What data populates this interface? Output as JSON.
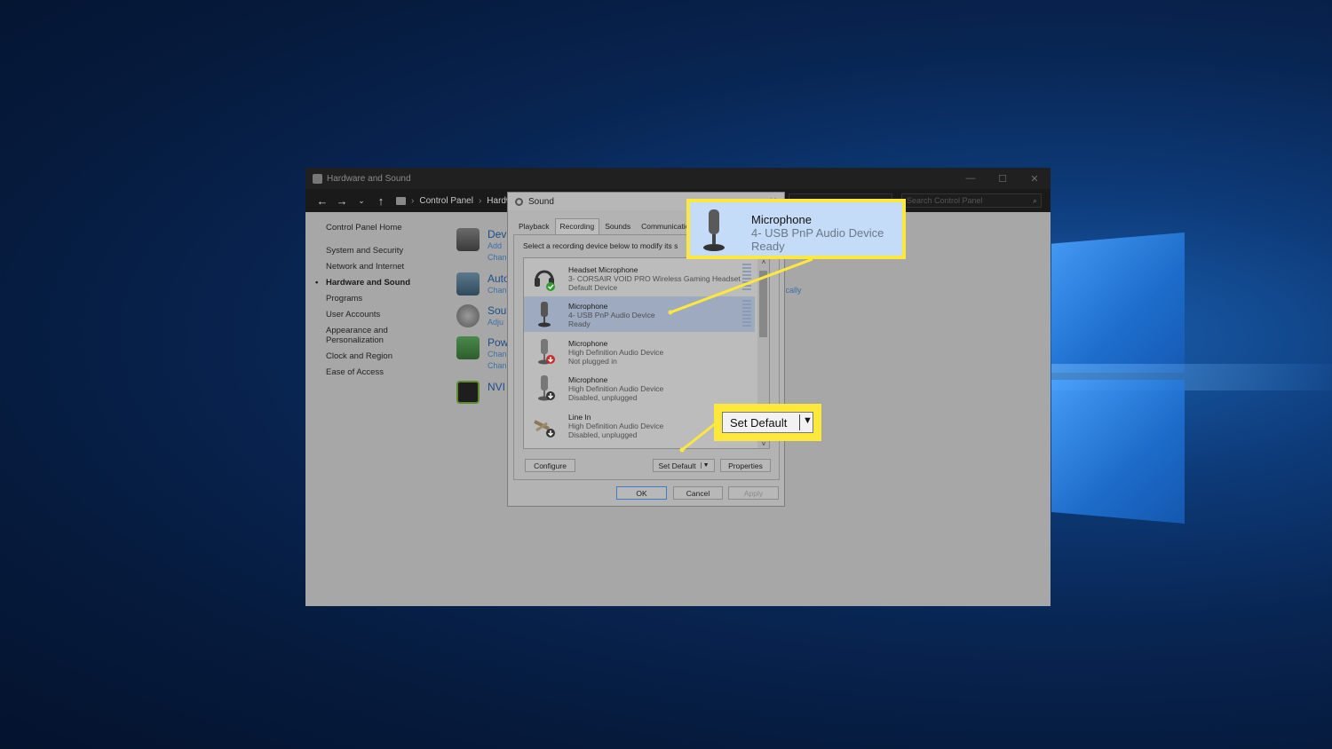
{
  "colors": {
    "callout_border": "#ffe83c",
    "selection": "#9daac0",
    "link": "#1b4d8c"
  },
  "cp_window": {
    "title": "Hardware and Sound",
    "breadcrumb": [
      "Control Panel",
      "Hardware"
    ],
    "search_placeholder": "Search Control Panel"
  },
  "sidebar": {
    "home": "Control Panel Home",
    "items": [
      "System and Security",
      "Network and Internet",
      "Hardware and Sound",
      "Programs",
      "User Accounts",
      "Appearance and Personalization",
      "Clock and Region",
      "Ease of Access"
    ]
  },
  "categories": [
    {
      "title": "Devi",
      "lines": [
        "Add",
        "Chan"
      ],
      "icon": "printer-icon"
    },
    {
      "title": "Auto",
      "lines": [
        "Chan"
      ],
      "icon": "autoplay-icon"
    },
    {
      "title": "Soun",
      "lines": [
        "Adju"
      ],
      "icon": "speaker-icon"
    },
    {
      "title": "Pow",
      "lines": [
        "Chan",
        "Chan"
      ],
      "icon": "power-icon"
    },
    {
      "title": "NVI",
      "lines": [],
      "icon": "nvidia-icon"
    }
  ],
  "right_fragment": "tically",
  "sound_dialog": {
    "title": "Sound",
    "tabs": [
      "Playback",
      "Recording",
      "Sounds",
      "Communications"
    ],
    "selected_tab": "Recording",
    "instruction": "Select a recording device below to modify its s",
    "devices": [
      {
        "name": "Headset Microphone",
        "desc": "3- CORSAIR VOID PRO Wireless Gaming Headset",
        "status": "Default Device"
      },
      {
        "name": "Microphone",
        "desc": "4- USB PnP Audio Device",
        "status": "Ready"
      },
      {
        "name": "Microphone",
        "desc": "High Definition Audio Device",
        "status": "Not plugged in"
      },
      {
        "name": "Microphone",
        "desc": "High Definition Audio Device",
        "status": "Disabled, unplugged"
      },
      {
        "name": "Line In",
        "desc": "High Definition Audio Device",
        "status": "Disabled, unplugged"
      }
    ],
    "buttons": {
      "configure": "Configure",
      "set_default": "Set Default",
      "properties": "Properties",
      "ok": "OK",
      "cancel": "Cancel",
      "apply": "Apply"
    }
  },
  "callout_mic": {
    "name": "Microphone",
    "desc": "4- USB PnP Audio Device",
    "status": "Ready"
  },
  "callout_set": {
    "label": "Set Default"
  }
}
